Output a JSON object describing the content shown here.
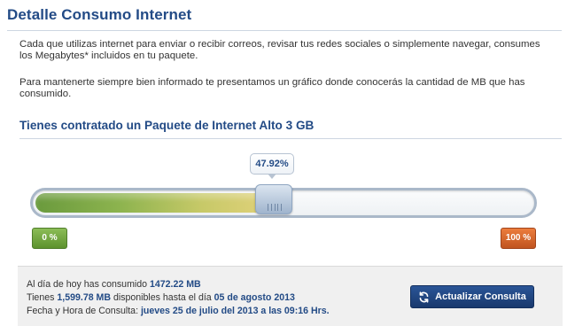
{
  "page": {
    "title": "Detalle Consumo Internet",
    "intro_1": "Cada que utilizas internet para enviar o recibir correos, revisar tus redes sociales o simplemente navegar, consumes los Megabytes* incluidos en tu paquete.",
    "intro_2": "Para mantenerte siempre bien informado te presentamos un gráfico donde conocerás la cantidad de MB que has consumido."
  },
  "plan": {
    "title": "Tienes contratado un Paquete de Internet Alto 3 GB"
  },
  "usage_meter": {
    "percent_label": "47.92%",
    "percent_value": 47.92,
    "min_label": "0 %",
    "max_label": "100 %",
    "colors": {
      "fill_start": "#6a9a3d",
      "fill_end": "#e2d27b",
      "min_badge": "#5d922d",
      "max_badge": "#c0541f"
    }
  },
  "summary": {
    "consumed_prefix": "Al día de hoy has consumido ",
    "consumed_value": "1472.22 MB",
    "available_prefix": "Tienes ",
    "available_value": "1,599.78 MB",
    "available_middle": " disponibles hasta el día ",
    "available_date": "05 de agosto 2013",
    "query_prefix": "Fecha y Hora de Consulta: ",
    "query_value": "jueves 25 de julio del 2013 a las 09:16 Hrs.",
    "refresh_label": "Actualizar Consulta",
    "refresh_icon": "refresh-icon",
    "button_color": "#19396d"
  }
}
